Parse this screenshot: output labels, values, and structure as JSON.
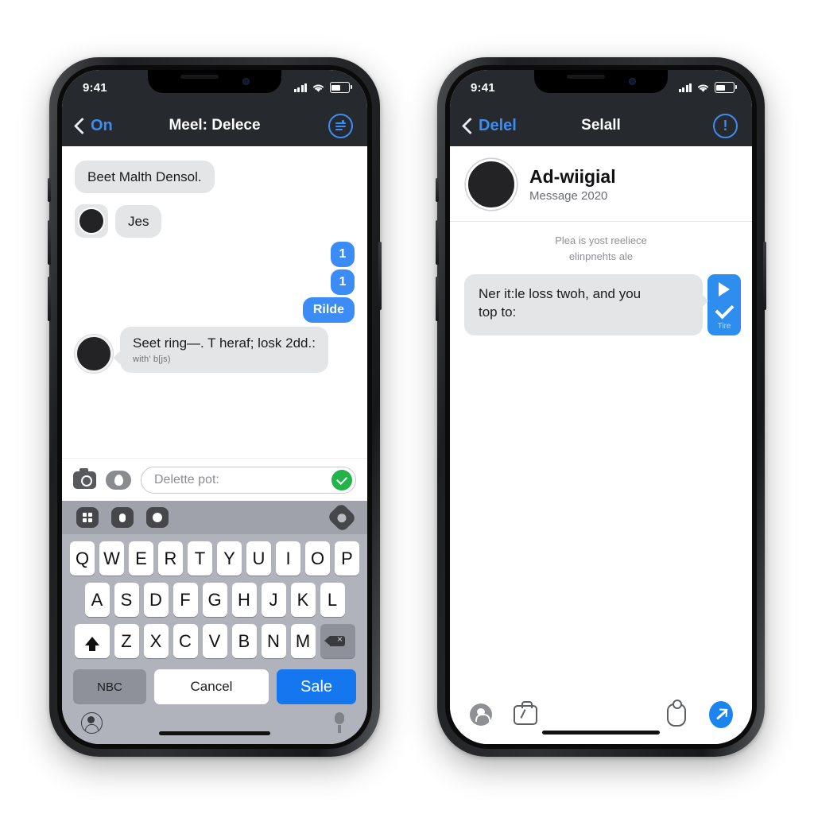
{
  "left_phone": {
    "status_bar": {
      "time": "9:41",
      "signal_icon": "cellular-bars-icon",
      "wifi_icon": "wifi-icon",
      "battery_icon": "battery-icon"
    },
    "nav_bar": {
      "back_label": "On",
      "title": "Meel: Delece",
      "right_icon": "filter-sliders-icon"
    },
    "messages": [
      {
        "id": "m1",
        "side": "left",
        "text": "Beet Malth Densol.",
        "has_avatar": false
      },
      {
        "id": "m2",
        "side": "left",
        "text": "Jes",
        "has_avatar": true
      },
      {
        "id": "m3",
        "side": "left",
        "text": "Seet ring—. T heraf; losk 2dd.:",
        "sub": "with' b[js)",
        "has_avatar": true
      }
    ],
    "tags": [
      {
        "label": "1",
        "style": "small"
      },
      {
        "label": "1",
        "style": "small"
      },
      {
        "label": "Rilde",
        "style": "wide"
      }
    ],
    "input_bar": {
      "camera_icon": "camera-icon",
      "apps_icon": "location-pin-icon",
      "placeholder": "Delette pot:",
      "send_icon": "checkmark-send-icon"
    },
    "keyboard": {
      "accessory": [
        "grid-icon",
        "mic-icon",
        "phone-icon",
        "emoji-icon"
      ],
      "row1": [
        "Q",
        "W",
        "E",
        "R",
        "T",
        "Y",
        "U",
        "I",
        "O",
        "P"
      ],
      "row2": [
        "A",
        "S",
        "D",
        "F",
        "G",
        "H",
        "J",
        "K",
        "L"
      ],
      "row3": [
        "Z",
        "X",
        "C",
        "V",
        "B",
        "N",
        "M"
      ],
      "shift_icon": "shift-arrow-icon",
      "delete_icon": "backspace-icon",
      "nbc_label": "NBC",
      "cancel_label": "Cancel",
      "sale_label": "Sale",
      "globe_icon": "globe-icon",
      "dictation_icon": "microphone-icon"
    }
  },
  "right_phone": {
    "status_bar": {
      "time": "9:41",
      "signal_icon": "cellular-bars-icon",
      "wifi_icon": "wifi-icon",
      "battery_icon": "battery-icon"
    },
    "nav_bar": {
      "back_label": "Delel",
      "title": "Selall",
      "right_icon": "info-circle-icon"
    },
    "contact": {
      "name": "Ad-wiigial",
      "subtitle": "Message 2020",
      "avatar_icon": "avatar"
    },
    "note_line1": "Plea is yost reeliece",
    "note_line2": "elinpnehts ale",
    "message": {
      "line1": "Ner it:le loss twoh, and you",
      "line2": "top to:"
    },
    "action_panel": {
      "play_icon": "play-icon",
      "check_icon": "check-icon",
      "label": "Tire"
    },
    "footer": {
      "lock_icon": "lock-badge-icon",
      "bag_icon": "briefcase-icon",
      "shield_icon": "shield-icon",
      "send_icon": "send-arrow-icon"
    }
  },
  "colors": {
    "accent_blue": "#3b8cf5",
    "send_blue": "#1477ef",
    "green": "#22b34a",
    "bubble_grey": "#e4e5e7",
    "navbar_dark": "#262a2e"
  }
}
